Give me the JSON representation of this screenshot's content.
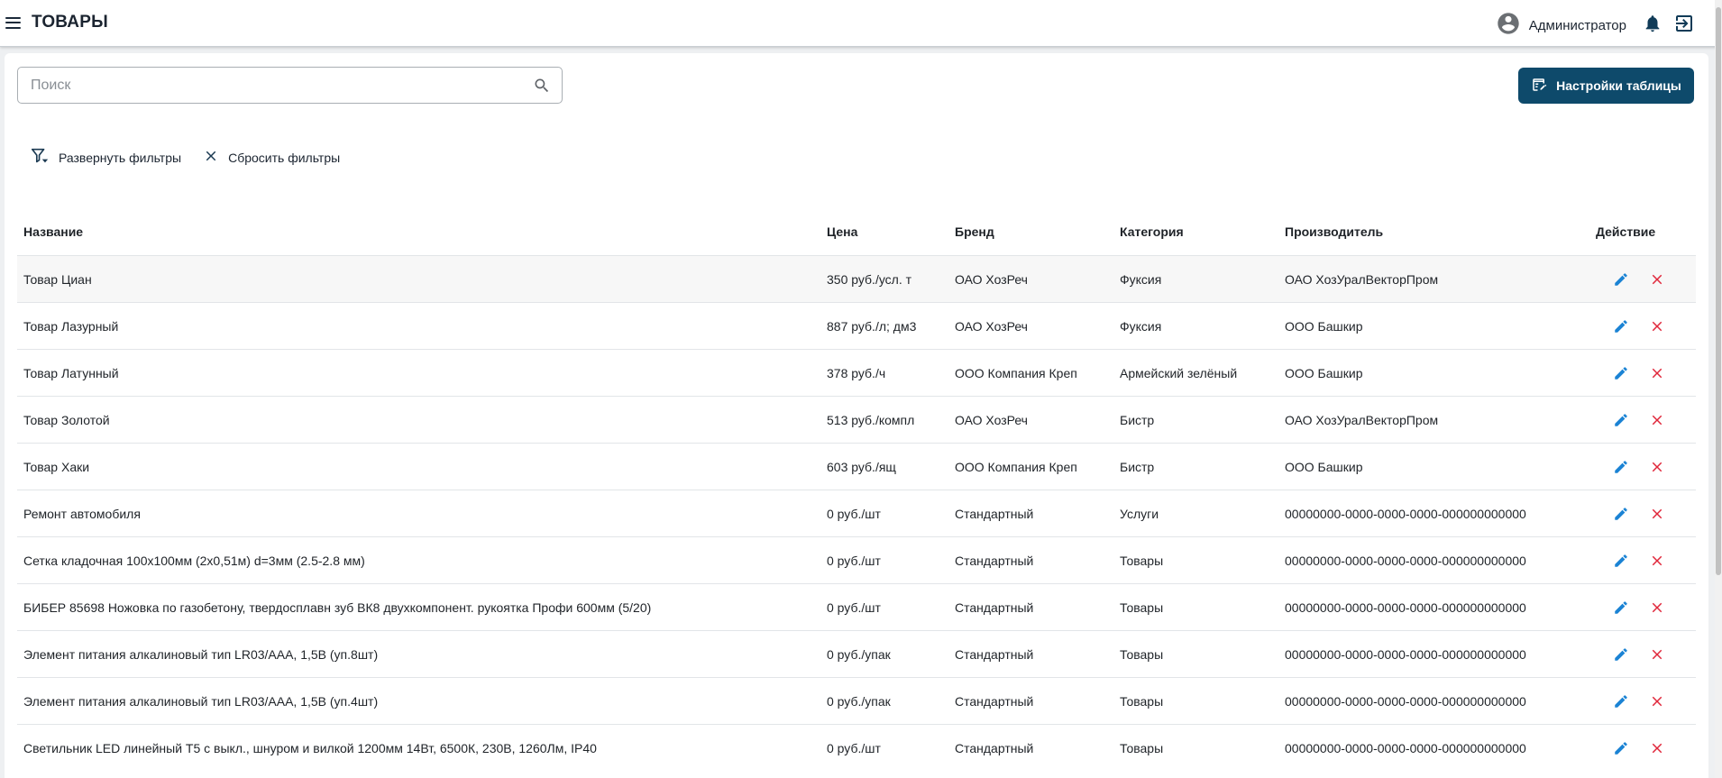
{
  "header": {
    "title": "ТОВАРЫ",
    "user_name": "Администратор",
    "icons": [
      "menu-icon",
      "account-circle-icon",
      "bell-icon",
      "logout-icon"
    ]
  },
  "toolbar": {
    "search_placeholder": "Поиск",
    "search_value": "",
    "settings_label": "Настройки таблицы",
    "expand_filters_label": "Развернуть фильтры",
    "reset_filters_label": "Сбросить фильтры"
  },
  "colors": {
    "primary": "#0e4a6b",
    "edit_icon": "#1b83d4",
    "delete_icon": "#e0263a"
  },
  "table": {
    "columns": [
      "Название",
      "Цена",
      "Бренд",
      "Категория",
      "Производитель",
      "Действие"
    ],
    "rows": [
      {
        "name": "Товар Циан",
        "price": "350 руб./усл. т",
        "brand": "ОАО ХозРеч",
        "category": "Фуксия",
        "manufacturer": "ОАО ХозУралВекторПром"
      },
      {
        "name": "Товар Лазурный",
        "price": "887 руб./л; дм3",
        "brand": "ОАО ХозРеч",
        "category": "Фуксия",
        "manufacturer": "ООО Башкир"
      },
      {
        "name": "Товар Латунный",
        "price": "378 руб./ч",
        "brand": "ООО Компания Креп",
        "category": "Армейский зелёный",
        "manufacturer": "ООО Башкир"
      },
      {
        "name": "Товар Золотой",
        "price": "513 руб./компл",
        "brand": "ОАО ХозРеч",
        "category": "Бистр",
        "manufacturer": "ОАО ХозУралВекторПром"
      },
      {
        "name": "Товар Хаки",
        "price": "603 руб./ящ",
        "brand": "ООО Компания Креп",
        "category": "Бистр",
        "manufacturer": "ООО Башкир"
      },
      {
        "name": "Ремонт автомобиля",
        "price": "0 руб./шт",
        "brand": "Стандартный",
        "category": "Услуги",
        "manufacturer": "00000000-0000-0000-0000-000000000000"
      },
      {
        "name": "Сетка кладочная 100х100мм (2х0,51м) d=3мм (2.5-2.8 мм)",
        "price": "0 руб./шт",
        "brand": "Стандартный",
        "category": "Товары",
        "manufacturer": "00000000-0000-0000-0000-000000000000"
      },
      {
        "name": "БИБЕР 85698 Ножовка по газобетону, твердосплавн зуб ВК8 двухкомпонент. рукоятка Профи 600мм (5/20)",
        "price": "0 руб./шт",
        "brand": "Стандартный",
        "category": "Товары",
        "manufacturer": "00000000-0000-0000-0000-000000000000"
      },
      {
        "name": "Элемент питания алкалиновый тип LR03/AAA, 1,5В (уп.8шт)",
        "price": "0 руб./упак",
        "brand": "Стандартный",
        "category": "Товары",
        "manufacturer": "00000000-0000-0000-0000-000000000000"
      },
      {
        "name": "Элемент питания алкалиновый тип LR03/AAA, 1,5В (уп.4шт)",
        "price": "0 руб./упак",
        "brand": "Стандартный",
        "category": "Товары",
        "manufacturer": "00000000-0000-0000-0000-000000000000"
      },
      {
        "name": "Светильник LED линейный Т5 с выкл., шнуром и вилкой 1200мм 14Вт, 6500К, 230В, 1260Лм, IP40",
        "price": "0 руб./шт",
        "brand": "Стандартный",
        "category": "Товары",
        "manufacturer": "00000000-0000-0000-0000-000000000000"
      }
    ],
    "row_actions": [
      "pencil-edit-icon",
      "close-delete-icon"
    ]
  }
}
